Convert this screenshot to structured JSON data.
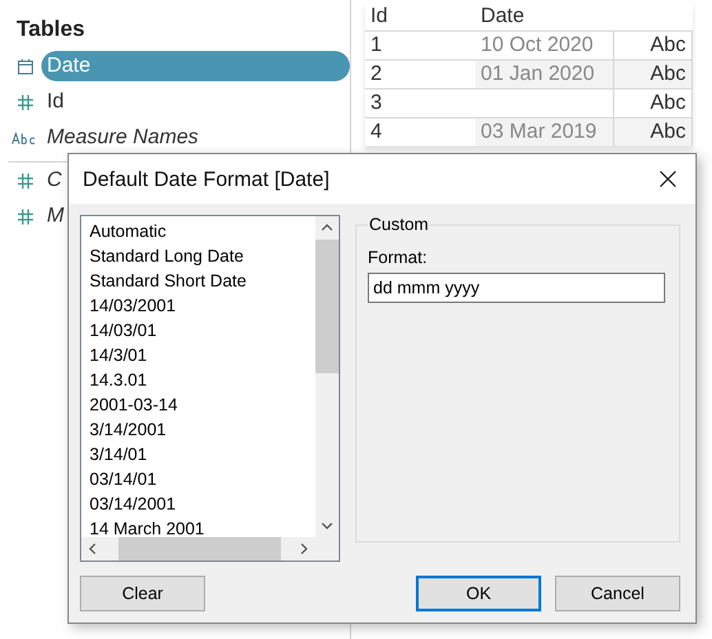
{
  "sidebar": {
    "title": "Tables",
    "fields": [
      {
        "kind": "date",
        "name": "Date",
        "generated": false,
        "selected": true
      },
      {
        "kind": "number",
        "name": "Id",
        "generated": false,
        "selected": false
      },
      {
        "kind": "string",
        "name": "Measure Names",
        "generated": true,
        "selected": false
      },
      {
        "kind": "number",
        "name": "C",
        "generated": true,
        "selected": false
      },
      {
        "kind": "number",
        "name": "M",
        "generated": true,
        "selected": false
      }
    ]
  },
  "table": {
    "columns": [
      "Id",
      "Date"
    ],
    "rows": [
      {
        "cells": [
          "1",
          "10 Oct 2020",
          "Abc"
        ]
      },
      {
        "cells": [
          "2",
          "01 Jan 2020",
          "Abc"
        ]
      },
      {
        "cells": [
          "3",
          "",
          "Abc"
        ]
      },
      {
        "cells": [
          "4",
          "03 Mar 2019",
          "Abc"
        ]
      }
    ]
  },
  "dialog": {
    "title": "Default Date Format [Date]",
    "formats": [
      {
        "label": "Automatic",
        "selected": false
      },
      {
        "label": "Standard Long Date",
        "selected": false
      },
      {
        "label": "Standard Short Date",
        "selected": false
      },
      {
        "label": "14/03/2001",
        "selected": false
      },
      {
        "label": "14/03/01",
        "selected": false
      },
      {
        "label": "14/3/01",
        "selected": false
      },
      {
        "label": "14.3.01",
        "selected": false
      },
      {
        "label": "2001-03-14",
        "selected": false
      },
      {
        "label": "3/14/2001",
        "selected": false
      },
      {
        "label": "3/14/01",
        "selected": false
      },
      {
        "label": "03/14/01",
        "selected": false
      },
      {
        "label": "03/14/2001",
        "selected": false
      },
      {
        "label": "14 March 2001",
        "selected": false
      }
    ],
    "custom": {
      "title": "Custom",
      "format_label": "Format:",
      "format_value": "dd mmm yyyy"
    },
    "buttons": [
      {
        "label": "Clear",
        "default": false
      },
      {
        "label": "OK",
        "default": true
      },
      {
        "label": "Cancel",
        "default": false
      }
    ]
  }
}
